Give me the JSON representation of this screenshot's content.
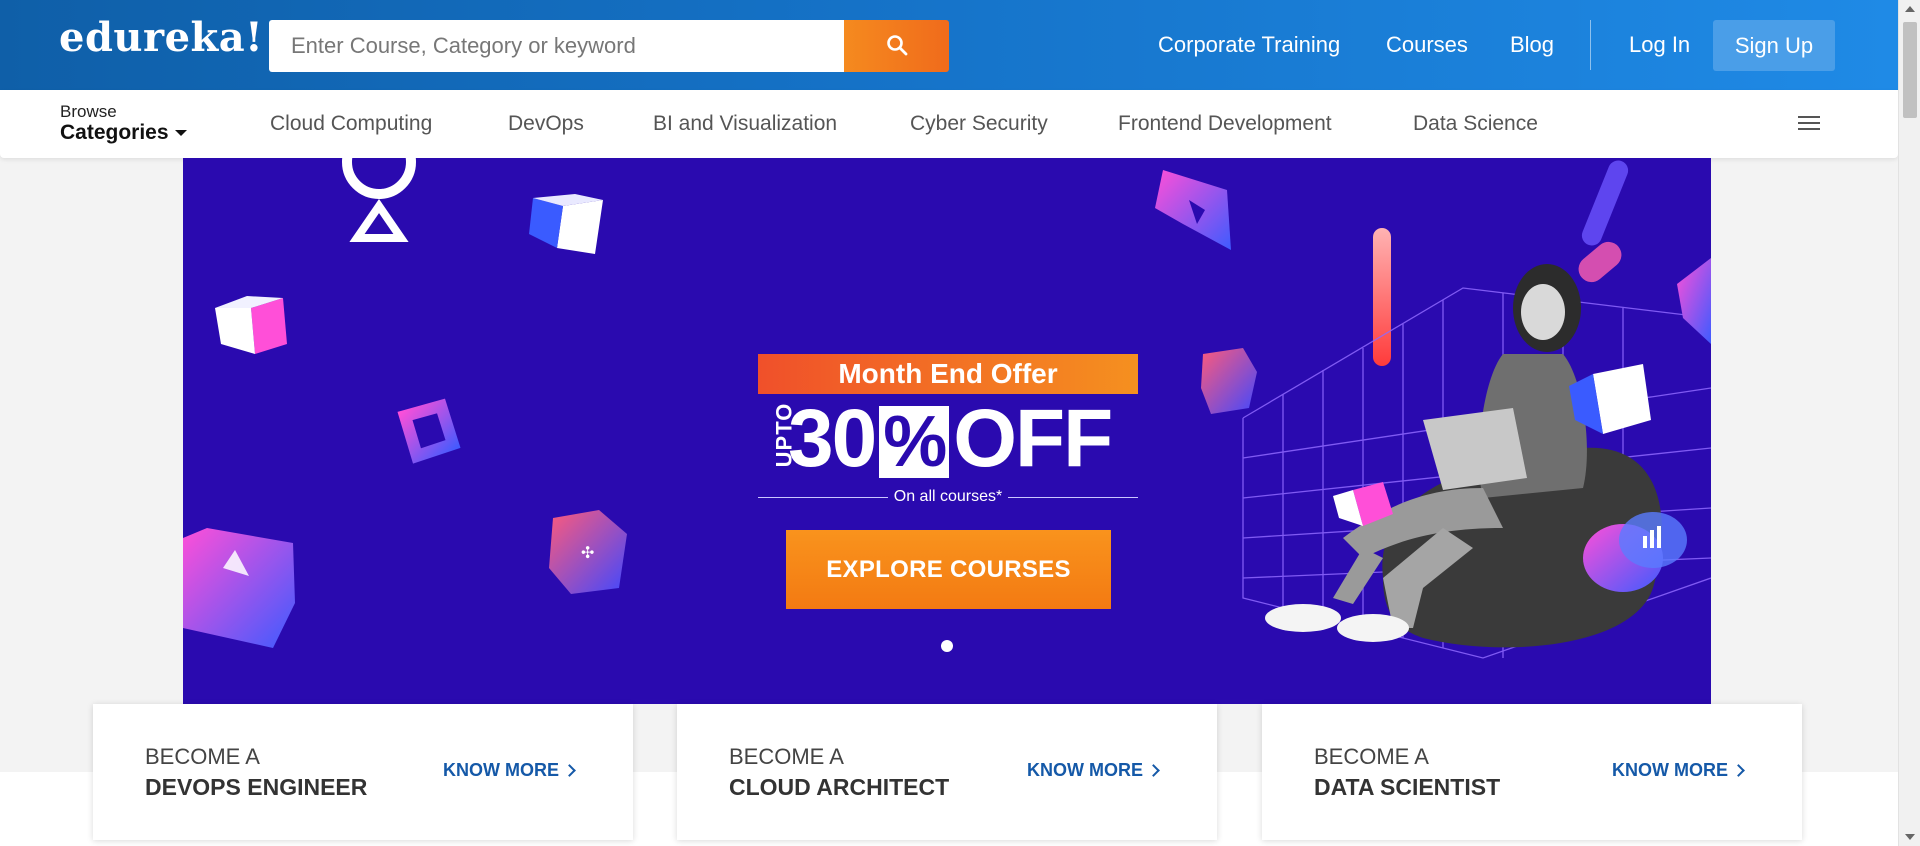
{
  "header": {
    "logo": "edureka!",
    "search": {
      "placeholder": "Enter Course, Category or keyword",
      "icon": "search-icon"
    },
    "nav": {
      "corporate_training": "Corporate Training",
      "courses": "Courses",
      "blog": "Blog",
      "login": "Log In",
      "signup": "Sign Up"
    }
  },
  "category_bar": {
    "browse_small": "Browse",
    "browse_big": "Categories",
    "items": [
      "Cloud Computing",
      "DevOps",
      "BI and Visualization",
      "Cyber Security",
      "Frontend Development",
      "Data Science"
    ],
    "menu_icon": "hamburger-menu-icon"
  },
  "hero": {
    "badge": "Month End Offer",
    "upto": "UPTO",
    "percent_number": "30",
    "percent_sign": "%",
    "off": "OFF",
    "subtext": "On all courses*",
    "cta": "EXPLORE COURSES",
    "slides_total": 1,
    "active_slide": 1
  },
  "cards": [
    {
      "line1": "BECOME A",
      "line2": "DEVOPS ENGINEER",
      "link": "KNOW MORE"
    },
    {
      "line1": "BECOME A",
      "line2": "CLOUD ARCHITECT",
      "link": "KNOW MORE"
    },
    {
      "line1": "BECOME A",
      "line2": "DATA SCIENTIST",
      "link": "KNOW MORE"
    }
  ],
  "colors": {
    "header_from": "#0f5fa8",
    "header_to": "#1f8ae6",
    "search_button": "#f5821f",
    "hero_background": "#2a0aaf",
    "cta_orange": "#f7861a",
    "link_blue": "#1559a8"
  }
}
